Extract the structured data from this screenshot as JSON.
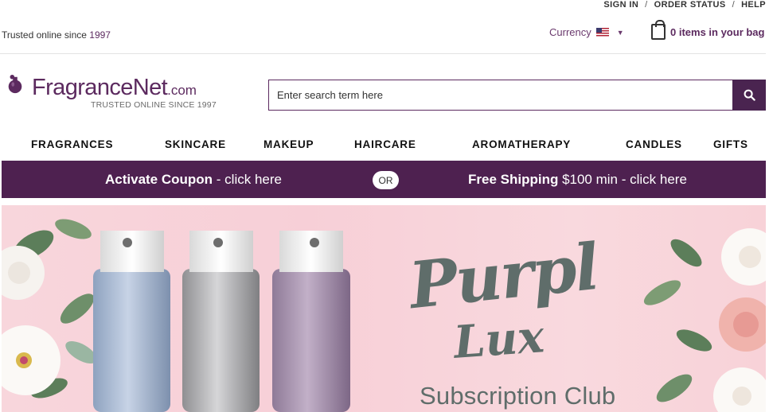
{
  "utility_nav": {
    "sign_in": "SIGN IN",
    "separator": "/",
    "order_status": "ORDER STATUS",
    "help": "HELP"
  },
  "top": {
    "trusted_prefix": "Trusted online since ",
    "trusted_year": "1997",
    "currency_label": "Currency",
    "currency_flag_icon": "us-flag-icon",
    "bag_text": "0 items in your bag"
  },
  "logo": {
    "name": "FragranceNet",
    "suffix": ".com",
    "tagline": "TRUSTED ONLINE SINCE 1997"
  },
  "search": {
    "placeholder": "Enter search term here",
    "button_icon": "search-icon"
  },
  "nav": {
    "items": [
      "FRAGRANCES",
      "SKINCARE",
      "MAKEUP",
      "HAIRCARE",
      "AROMATHERAPY",
      "CANDLES",
      "GIFTS"
    ]
  },
  "promo": {
    "coupon_bold": "Activate Coupon",
    "coupon_rest": " - click here",
    "or": "OR",
    "ship_bold": "Free Shipping",
    "ship_rest": " $100 min - click here"
  },
  "hero": {
    "script_line1": "Purpl",
    "script_line2": "Lux",
    "subtitle": "Subscription Club"
  },
  "colors": {
    "brand_purple": "#5c2a5f",
    "promo_bar": "#4e2150",
    "hero_pink": "#f8d6dc",
    "hero_text": "#5f6d6a"
  }
}
